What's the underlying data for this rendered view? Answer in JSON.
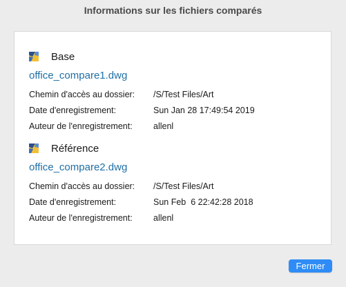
{
  "window": {
    "title": "Informations sur les fichiers comparés"
  },
  "base": {
    "heading": "Base",
    "filename": "office_compare1.dwg",
    "rows": [
      {
        "label": "Chemin d'accès au dossier:",
        "value": "/S/Test Files/Art"
      },
      {
        "label": "Date d'enregistrement:",
        "value": "Sun Jan 28 17:49:54 2019"
      },
      {
        "label": "Auteur de l'enregistrement:",
        "value": "allenl"
      }
    ]
  },
  "reference": {
    "heading": "Référence",
    "filename": "office_compare2.dwg",
    "rows": [
      {
        "label": "Chemin d'accès au dossier:",
        "value": "/S/Test Files/Art"
      },
      {
        "label": "Date d'enregistrement:",
        "value": "Sun Feb  6 22:42:28 2018"
      },
      {
        "label": "Auteur de l'enregistrement:",
        "value": "allenl"
      }
    ]
  },
  "footer": {
    "close_label": "Fermer"
  },
  "icons": {
    "file_icon": "dwg-file-icon"
  },
  "colors": {
    "accent": "#2f8cf6",
    "link": "#1f6fa6"
  }
}
